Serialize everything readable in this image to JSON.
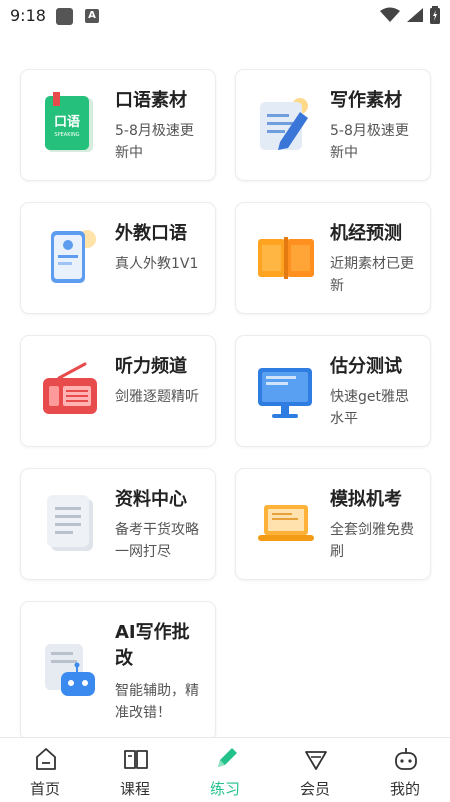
{
  "status_bar": {
    "time": "9:18",
    "badge": "A"
  },
  "cards": [
    {
      "title": "口语素材",
      "desc": "5-8月极速更新中",
      "icon": "speaking-book-icon"
    },
    {
      "title": "写作素材",
      "desc": "5-8月极速更新中",
      "icon": "writing-document-icon"
    },
    {
      "title": "外教口语",
      "desc": "真人外教1V1",
      "icon": "video-phone-icon"
    },
    {
      "title": "机经预测",
      "desc": "近期素材已更新",
      "icon": "open-book-icon"
    },
    {
      "title": "听力频道",
      "desc": "剑雅逐题精听",
      "icon": "radio-icon"
    },
    {
      "title": "估分测试",
      "desc": "快速get雅思水平",
      "icon": "monitor-icon"
    },
    {
      "title": "资料中心",
      "desc": "备考干货攻略一网打尽",
      "icon": "document-stack-icon"
    },
    {
      "title": "模拟机考",
      "desc": "全套剑雅免费刷",
      "icon": "laptop-icon"
    },
    {
      "title": "AI写作批改",
      "desc": "智能辅助，精准改错！",
      "icon": "ai-robot-icon"
    }
  ],
  "nav": {
    "active": "练习",
    "items": [
      {
        "label": "首页",
        "icon": "home-icon"
      },
      {
        "label": "课程",
        "icon": "course-book-icon"
      },
      {
        "label": "练习",
        "icon": "pencil-icon"
      },
      {
        "label": "会员",
        "icon": "vip-diamond-icon"
      },
      {
        "label": "我的",
        "icon": "profile-robot-icon"
      }
    ]
  },
  "colors": {
    "accent": "#22c28a"
  }
}
